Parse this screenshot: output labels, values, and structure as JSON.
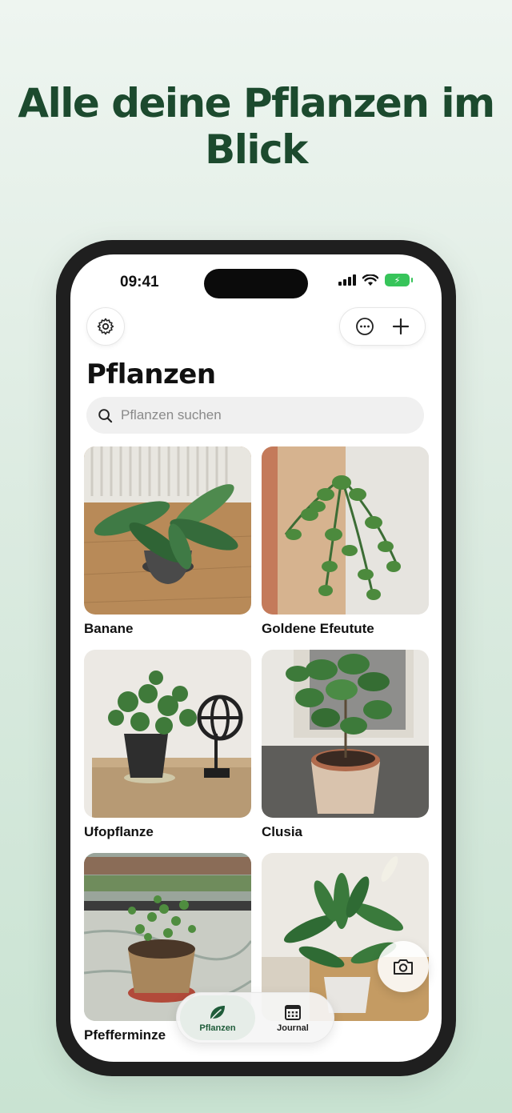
{
  "headline": "Alle deine Pflanzen im Blick",
  "status_bar": {
    "time": "09:41"
  },
  "header": {
    "title": "Pflanzen"
  },
  "search": {
    "placeholder": "Pflanzen suchen"
  },
  "plants": [
    {
      "name": "Banane"
    },
    {
      "name": "Goldene Efeutute"
    },
    {
      "name": "Ufopflanze"
    },
    {
      "name": "Clusia"
    },
    {
      "name": "Pfefferminze"
    },
    {
      "name": ""
    }
  ],
  "tab_bar": {
    "tabs": [
      {
        "label": "Pflanzen",
        "active": true
      },
      {
        "label": "Journal",
        "active": false
      }
    ]
  },
  "icons": {
    "settings": "gear-icon",
    "more": "more-horizontal-icon",
    "add": "plus-icon",
    "search": "search-icon",
    "camera": "camera-icon",
    "plants_tab": "leaf-icon",
    "journal_tab": "calendar-icon"
  },
  "colors": {
    "headline": "#1c4a2e",
    "accent": "#1f5c3a",
    "battery": "#37c45a"
  }
}
